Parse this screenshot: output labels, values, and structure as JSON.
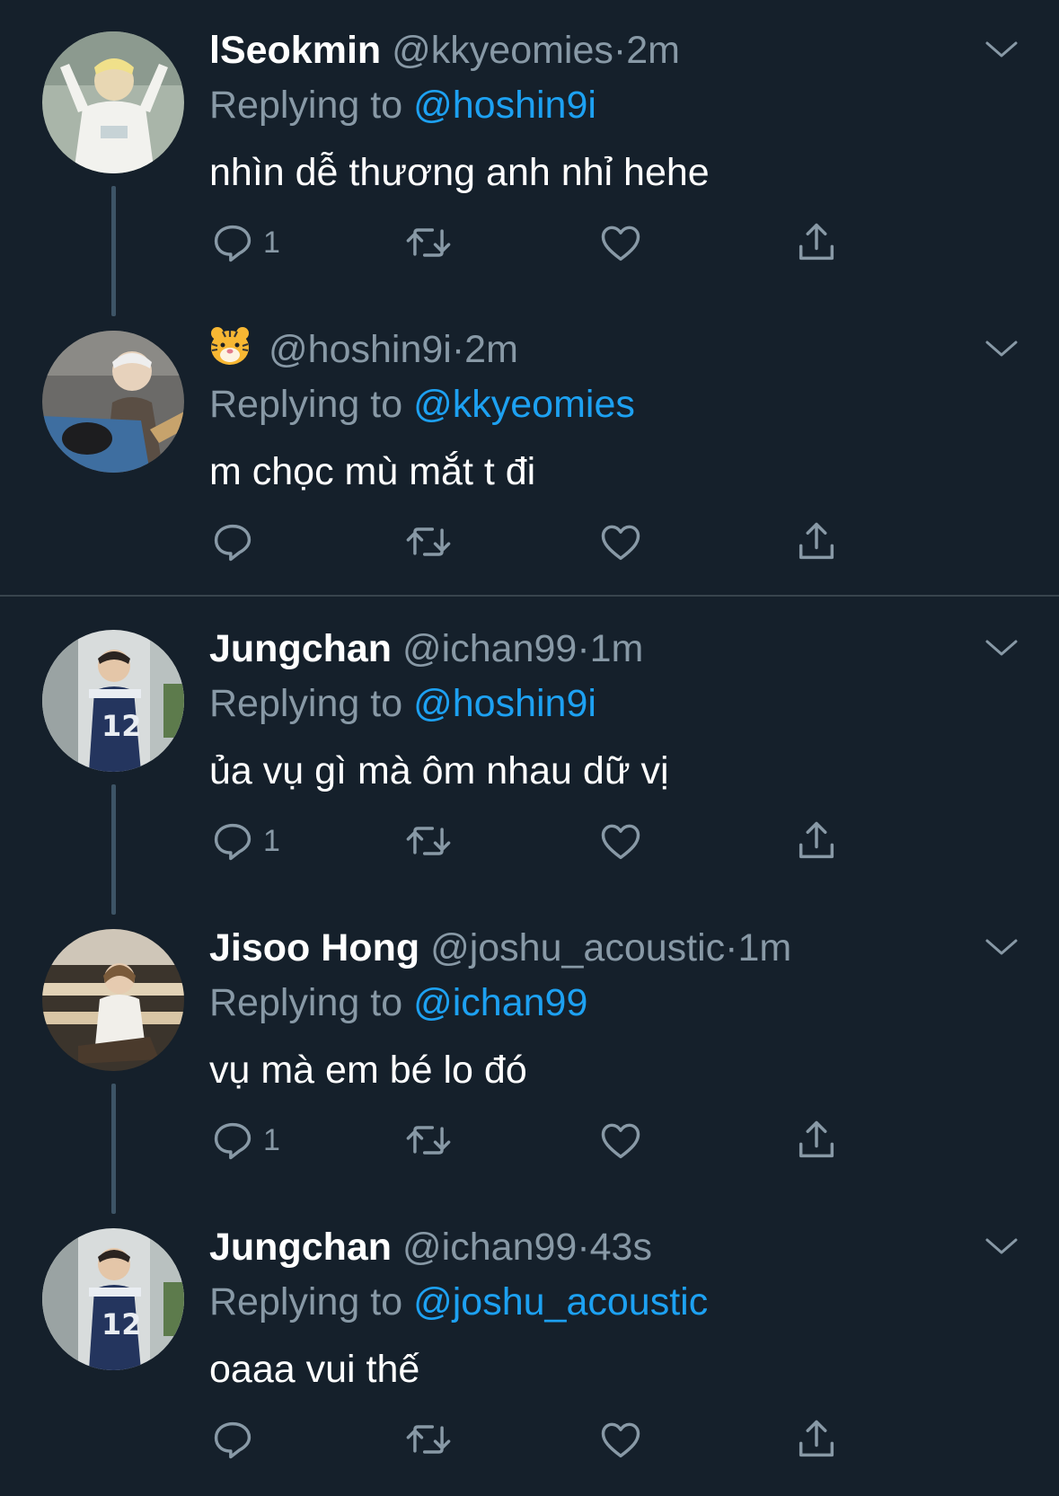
{
  "colors": {
    "background": "#15202b",
    "muted": "#8899a6",
    "accent": "#1da1f2",
    "text": "#ffffff"
  },
  "icons": {
    "reply": "reply-icon",
    "retweet": "retweet-icon",
    "like": "heart-icon",
    "share": "share-icon",
    "more": "chevron-down-icon"
  },
  "tweets": [
    {
      "name": "lSeokmin",
      "handle": "@kkyeomies",
      "separator": "·",
      "time": "2m",
      "replying_prefix": "Replying to",
      "replying_to": "@hoshin9i",
      "text": "nhìn dễ thương anh nhỉ hehe",
      "reply_count": "1"
    },
    {
      "name": "🐯",
      "handle": "@hoshin9i",
      "separator": "·",
      "time": "2m",
      "replying_prefix": "Replying to",
      "replying_to": "@kkyeomies",
      "text": "m chọc mù mắt t đi",
      "reply_count": ""
    },
    {
      "name": "Jungchan",
      "handle": "@ichan99",
      "separator": "·",
      "time": "1m",
      "replying_prefix": "Replying to",
      "replying_to": "@hoshin9i",
      "text": "ủa vụ gì mà ôm nhau dữ vị",
      "reply_count": "1"
    },
    {
      "name": "Jisoo Hong",
      "handle": "@joshu_acoustic",
      "separator": "·",
      "time": "1m",
      "replying_prefix": "Replying to",
      "replying_to": "@ichan99",
      "text": "vụ mà em bé lo đó",
      "reply_count": "1"
    },
    {
      "name": "Jungchan",
      "handle": "@ichan99",
      "separator": "·",
      "time": "43s",
      "replying_prefix": "Replying to",
      "replying_to": "@joshu_acoustic",
      "text": "oaaa vui thế",
      "reply_count": ""
    }
  ]
}
